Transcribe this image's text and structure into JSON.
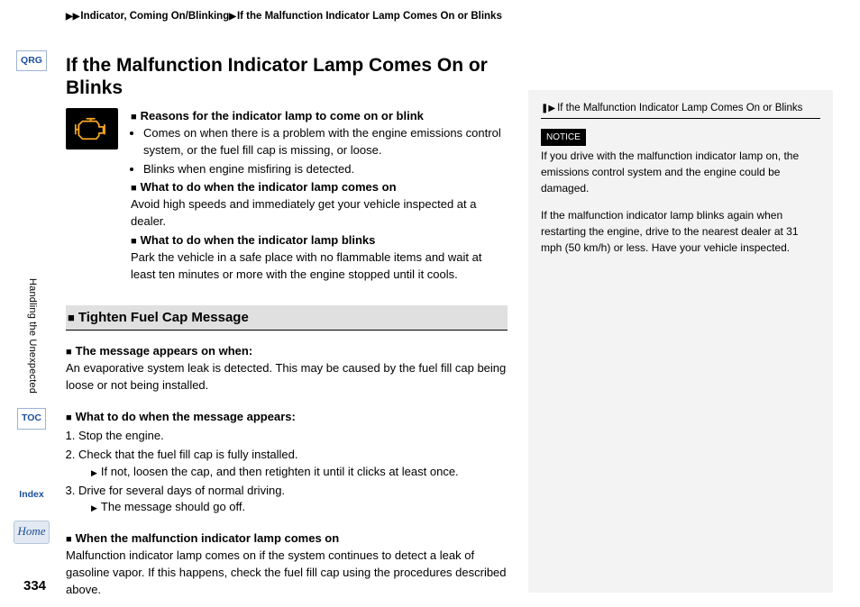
{
  "breadcrumb": {
    "seg1": "Indicator, Coming On/Blinking",
    "seg2": "If the Malfunction Indicator Lamp Comes On or Blinks"
  },
  "nav": {
    "qrg": "QRG",
    "vtext": "Handling the Unexpected",
    "toc": "TOC",
    "index": "Index",
    "home": "Home"
  },
  "title": "If the Malfunction Indicator Lamp Comes On or Blinks",
  "icon_name": "check-engine",
  "section1": {
    "hdr1": "Reasons for the indicator lamp to come on or blink",
    "bullets": [
      "Comes on when there is a problem with the engine emissions control system, or the fuel fill cap is missing, or loose.",
      "Blinks when engine misfiring is detected."
    ],
    "hdr2": "What to do when the indicator lamp comes on",
    "p2": "Avoid high speeds and immediately get your vehicle inspected at a dealer.",
    "hdr3": "What to do when the indicator lamp blinks",
    "p3": "Park the vehicle in a safe place with no flammable items and wait at least ten minutes or more with the engine stopped until it cools."
  },
  "section2": {
    "bar": "Tighten Fuel Cap Message",
    "hdrA": "The message appears on when:",
    "pA": "An evaporative system leak is detected. This may be caused by the fuel fill cap being loose or not being installed.",
    "hdrB": "What to do when the message appears:",
    "steps": {
      "s1": "Stop the engine.",
      "s2": "Check that the fuel fill cap is fully installed.",
      "s2sub": "If not, loosen the cap, and then retighten it until it clicks at least once.",
      "s3": "Drive for several days of normal driving.",
      "s3sub": "The message should go off."
    },
    "hdrC": "When the malfunction indicator lamp comes on",
    "pC": "Malfunction indicator lamp comes on if the system continues to detect a leak of gasoline vapor. If this happens, check the fuel fill cap using the procedures described above."
  },
  "side": {
    "title": "If the Malfunction Indicator Lamp Comes On or Blinks",
    "notice": "NOTICE",
    "p1": "If you drive with the malfunction indicator lamp on, the emissions control system and the engine could be damaged.",
    "p2": "If the malfunction indicator lamp blinks again when restarting the engine, drive to the nearest dealer at 31 mph (50 km/h) or less. Have your vehicle inspected."
  },
  "page_number": "334"
}
